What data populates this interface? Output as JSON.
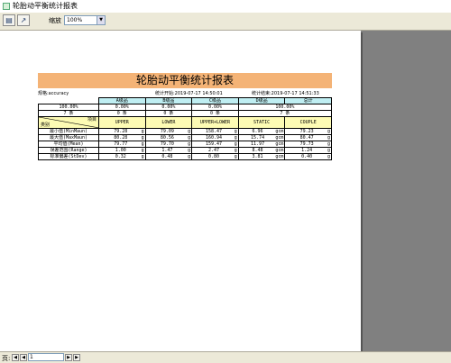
{
  "window": {
    "title": "轮胎动平衡统计报表"
  },
  "toolbar": {
    "zoom_label": "缩放",
    "zoom_value": "100%"
  },
  "report": {
    "title": "轮胎动平衡统计报表",
    "spec": "规格:accuracy",
    "start": "统计开始:2019-07-17 14:50:01",
    "end": "统计结束:2019-07-17 14:51:33",
    "grade_headers": [
      "A级品",
      "B级品",
      "C级品",
      "D级品",
      "总计"
    ],
    "grade_pct": [
      "100.00%",
      "0.00%",
      "0.00%",
      "0.00%",
      "100.00%"
    ],
    "grade_count": [
      "7 条",
      "0 条",
      "0 条",
      "0 条",
      "7 条"
    ],
    "col_corner_top": "项目",
    "col_corner_bottom": "类别",
    "col_headers": [
      "UPPER",
      "LOWER",
      "UPPER+LOWER",
      "STATIC",
      "COUPLE"
    ],
    "rows": [
      {
        "label": "最小值(MinMaun)",
        "cells": [
          {
            "v": "79.28",
            "u": "g"
          },
          {
            "v": "79.09",
            "u": "g"
          },
          {
            "v": "158.47",
            "u": "g"
          },
          {
            "v": "6.96",
            "u": "gcm"
          },
          {
            "v": "79.23",
            "u": "g"
          }
        ]
      },
      {
        "label": "最大值(MaxMaun)",
        "cells": [
          {
            "v": "80.28",
            "u": "g"
          },
          {
            "v": "80.56",
            "u": "g"
          },
          {
            "v": "160.94",
            "u": "g"
          },
          {
            "v": "15.74",
            "u": "gcm"
          },
          {
            "v": "80.47",
            "u": "g"
          }
        ]
      },
      {
        "label": "平均值(Mean)",
        "cells": [
          {
            "v": "79.77",
            "u": "g"
          },
          {
            "v": "79.70",
            "u": "g"
          },
          {
            "v": "159.47",
            "u": "g"
          },
          {
            "v": "11.97",
            "u": "gcm"
          },
          {
            "v": "79.73",
            "u": "g"
          }
        ]
      },
      {
        "label": "误差范围(Range)",
        "cells": [
          {
            "v": "1.00",
            "u": "g"
          },
          {
            "v": "1.47",
            "u": "g"
          },
          {
            "v": "2.47",
            "u": "g"
          },
          {
            "v": "8.48",
            "u": "gcm"
          },
          {
            "v": "1.24",
            "u": "g"
          }
        ]
      },
      {
        "label": "标准偏差(StDev)",
        "cells": [
          {
            "v": "0.32",
            "u": "g"
          },
          {
            "v": "0.48",
            "u": "g"
          },
          {
            "v": "0.80",
            "u": "g"
          },
          {
            "v": "3.81",
            "u": "gcm"
          },
          {
            "v": "0.40",
            "u": "g"
          }
        ]
      }
    ]
  },
  "status": {
    "page_label": "页:",
    "page_value": "1"
  },
  "colors": {
    "banner": "#f4b376",
    "header_cyan": "#bfeef2",
    "header_yellow": "#fdfbb4"
  }
}
